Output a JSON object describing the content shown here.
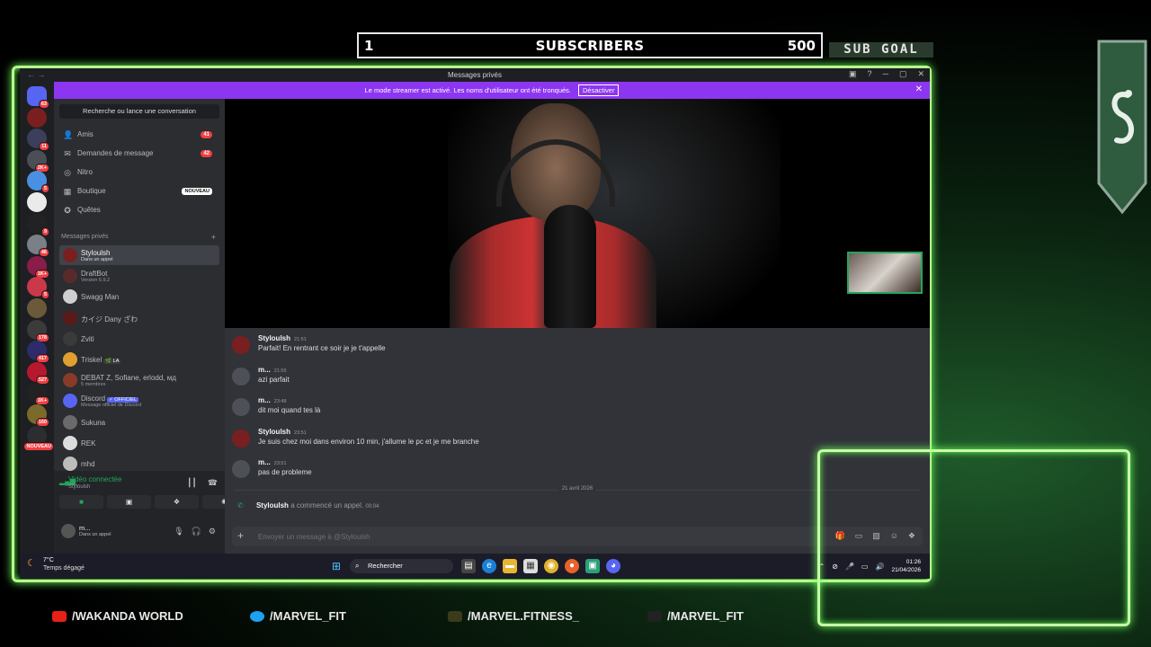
{
  "overlay": {
    "sub_current": "1",
    "sub_label": "SUBSCRIBERS",
    "sub_max": "500",
    "sub_goal": "SUB GOAL",
    "socials": [
      {
        "label": "/WAKANDA WORLD",
        "icon": "youtube-icon",
        "color": "#e62117"
      },
      {
        "label": "/MARVEL_FIT",
        "icon": "twitter-icon",
        "color": "#1da1f2"
      },
      {
        "label": "/MARVEL.FITNESS_",
        "icon": "snapchat-icon",
        "color": "#3b3b1a"
      },
      {
        "label": "/MARVEL_FIT",
        "icon": "tiktok-icon",
        "color": "#222222"
      }
    ],
    "frame_color": "#b8ff8c"
  },
  "window": {
    "title": "Messages privés",
    "streamer_notice": "Le mode streamer est activé. Les noms d'utilisateur ont été tronqués.",
    "streamer_button": "Désactiver",
    "accent": "#8d36f2"
  },
  "rail": {
    "servers": [
      {
        "badge": "63",
        "color": "#5865f2"
      },
      {
        "badge": "",
        "color": "#7a1f1f"
      },
      {
        "badge": "11",
        "color": "#3b3f5c"
      },
      {
        "badge": "2K+",
        "color": "#4a4f57"
      },
      {
        "badge": "5",
        "color": "#4a90e2"
      },
      {
        "badge": "",
        "color": "#eaeaea"
      },
      {
        "badge": "9",
        "color": "#222222"
      },
      {
        "badge": "46",
        "color": "#7b7f87"
      },
      {
        "badge": "1K+",
        "color": "#8a1c4a"
      },
      {
        "badge": "5",
        "color": "#c9394a"
      },
      {
        "badge": "",
        "color": "#6b5a3a"
      },
      {
        "badge": "178",
        "color": "#3b3b3b"
      },
      {
        "badge": "417",
        "color": "#2c2c6c"
      },
      {
        "badge": "527",
        "color": "#b8182e"
      },
      {
        "badge": "1K+",
        "color": "#222222"
      },
      {
        "badge": "160",
        "color": "#7b6a2a"
      },
      {
        "badge": "NOUVEAU",
        "color": "#2b2d31"
      }
    ]
  },
  "sidebar": {
    "search_placeholder": "Recherche ou lance une conversation",
    "menu": [
      {
        "label": "Amis",
        "icon": "friends-icon",
        "count": "41"
      },
      {
        "label": "Demandes de message",
        "icon": "mail-icon",
        "count": "42"
      },
      {
        "label": "Nitro",
        "icon": "nitro-icon",
        "count": ""
      },
      {
        "label": "Boutique",
        "icon": "shop-icon",
        "count": "",
        "tag": "NOUVEAU"
      },
      {
        "label": "Quêtes",
        "icon": "quests-icon",
        "count": ""
      }
    ],
    "section_title": "Messages privés",
    "dms": [
      {
        "name": "Styloulsh",
        "sub": "Dans un appel",
        "color": "#7a1f1f",
        "active": true
      },
      {
        "name": "DraftBot",
        "sub": "Version 6.9.2",
        "color": "#5a2a2a"
      },
      {
        "name": "Swagg Man",
        "sub": "",
        "color": "#cfcfcf"
      },
      {
        "name": "カイジ Dany ざわ",
        "sub": "",
        "color": "#5a1a1a"
      },
      {
        "name": "Zviti",
        "sub": "",
        "color": "#3a3a3a"
      },
      {
        "name": "Triskel",
        "sub": "",
        "tag": "🌿 LA",
        "color": "#e0a030"
      },
      {
        "name": "DEBAT Z, Sofiane, erlodd, мд",
        "sub": "5 membres",
        "color": "#8a3a2a"
      },
      {
        "name": "Discord",
        "sub": "Message officiel de Discord",
        "tag": "✓ OFFICIEL",
        "color": "#5865f2"
      },
      {
        "name": "Sukuna",
        "sub": "",
        "color": "#6a6a6a"
      },
      {
        "name": "REK",
        "sub": "",
        "color": "#dcdcdc"
      },
      {
        "name": "mhd",
        "sub": "",
        "color": "#bcbcbc"
      }
    ],
    "voice": {
      "status": "Vidéo connectée",
      "channel": "Styloulsh"
    },
    "user": {
      "name": "m...",
      "status": "Dans un appel"
    }
  },
  "chat": {
    "messages": [
      {
        "author": "Styloulsh",
        "time": "21:51",
        "text": "Parfait! En rentrant ce soir je je t'appelle",
        "color": "#7a1f1f"
      },
      {
        "author": "m...",
        "time": "21:55",
        "text": "azi parfait",
        "color": "#4e5058"
      },
      {
        "author": "m...",
        "time": "23:48",
        "text": "dit moi quand tes là",
        "color": "#4e5058"
      },
      {
        "author": "Styloulsh",
        "time": "23:51",
        "text": "Je suis chez moi dans environ 10 min, j'allume le pc et je me branche",
        "color": "#7a1f1f"
      },
      {
        "author": "m...",
        "time": "23:51",
        "text": "pas de probleme",
        "color": "#4e5058"
      }
    ],
    "date_divider": "21 avril 2026",
    "call_author": "Styloulsh",
    "call_text": "a commencé un appel.",
    "call_time": "00:04",
    "composer_placeholder": "Envoyer un message à @Styloulsh"
  },
  "taskbar": {
    "temp": "7°C",
    "weather": "Temps dégagé",
    "search": "Rechercher",
    "time": "01:26",
    "date": "21/04/2026"
  }
}
